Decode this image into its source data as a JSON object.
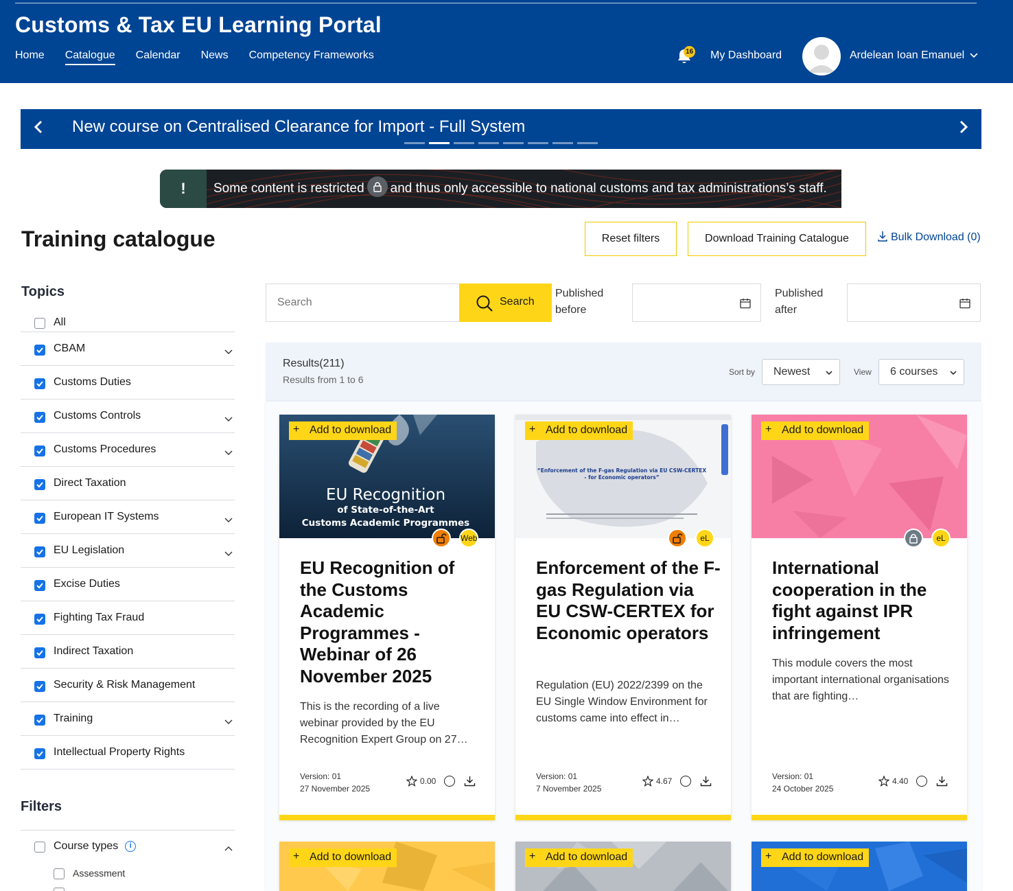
{
  "header": {
    "title": "Customs & Tax EU Learning Portal",
    "nav": [
      "Home",
      "Catalogue",
      "Calendar",
      "News",
      "Competency Frameworks"
    ],
    "notifications_count": "16",
    "dashboard_label": "My Dashboard",
    "user_name": "Ardelean Ioan Emanuel"
  },
  "carousel": {
    "headline": "New course on Centralised Clearance for Import - Full System",
    "slide_count": 8,
    "active_slide": 2
  },
  "notice": {
    "icon_text": "!",
    "text_before": "Some content is restricted",
    "text_after": "and thus only accessible to national customs and tax administrations’s staff."
  },
  "page": {
    "title": "Training catalogue",
    "reset_label": "Reset filters",
    "download_catalogue_label": "Download Training Catalogue",
    "bulk_download_label": "Bulk Download (0)"
  },
  "topics": {
    "heading": "Topics",
    "items": [
      {
        "label": "All",
        "checked": false,
        "expandable": false
      },
      {
        "label": "CBAM",
        "checked": true,
        "expandable": true
      },
      {
        "label": "Customs Duties",
        "checked": true,
        "expandable": false
      },
      {
        "label": "Customs Controls",
        "checked": true,
        "expandable": true
      },
      {
        "label": "Customs Procedures",
        "checked": true,
        "expandable": true
      },
      {
        "label": "Direct Taxation",
        "checked": true,
        "expandable": false
      },
      {
        "label": "European IT Systems",
        "checked": true,
        "expandable": true
      },
      {
        "label": "EU Legislation",
        "checked": true,
        "expandable": true
      },
      {
        "label": "Excise Duties",
        "checked": true,
        "expandable": false
      },
      {
        "label": "Fighting Tax Fraud",
        "checked": true,
        "expandable": false
      },
      {
        "label": "Indirect Taxation",
        "checked": true,
        "expandable": false
      },
      {
        "label": "Security & Risk Management",
        "checked": true,
        "expandable": false
      },
      {
        "label": "Training",
        "checked": true,
        "expandable": true
      },
      {
        "label": "Intellectual Property Rights",
        "checked": true,
        "expandable": false
      }
    ]
  },
  "filters": {
    "heading": "Filters",
    "course_types_label": "Course types",
    "course_types_info": "i",
    "course_type_options": [
      "Assessment"
    ]
  },
  "search": {
    "placeholder": "Search",
    "button_label": "Search",
    "published_before_line1": "Published",
    "published_before_line2": "before",
    "published_after_line1": "Published",
    "published_after_line2": "after"
  },
  "results": {
    "count_label": "Results(211)",
    "range_label": "Results from 1 to 6",
    "sort_by_label": "Sort by",
    "sort_value": "Newest",
    "view_label": "View",
    "view_value": "6 courses"
  },
  "cards": [
    {
      "add_label": "Add to download",
      "thumb_line1": "EU Recognition",
      "thumb_line2": "of State-of-the-Art",
      "thumb_line3": "Customs Academic Programmes",
      "format": "Web",
      "title": "EU Recognition of the Customs Academic Programmes - Webinar of 26 November 2025",
      "description": "This is the recording of a live webinar provided by the EU Recognition Expert Group on 27…",
      "version": "Version: 01",
      "date": "27 November 2025",
      "rating": "0.00"
    },
    {
      "add_label": "Add to download",
      "thumb_line1": "“Enforcement of the F-gas Regulation via EU CSW-CERTEX",
      "thumb_line2": "- for Economic operators”",
      "format": "eL",
      "title": "Enforcement of the F-gas Regulation via EU CSW-CERTEX for Economic operators",
      "description": "Regulation (EU) 2022/2399 on the EU Single Window Environment for customs came into effect in…",
      "version": "Version: 01",
      "date": "7 November 2025",
      "rating": "4.67"
    },
    {
      "add_label": "Add to download",
      "format": "eL",
      "title": "International cooperation in the fight against IPR infringement",
      "description": "This module covers the most important international organisations that are fighting…",
      "version": "Version: 01",
      "date": "24 October 2025",
      "rating": "4.40"
    },
    {
      "add_label": "Add to download"
    },
    {
      "add_label": "Add to download"
    },
    {
      "add_label": "Add to download"
    }
  ],
  "colors": {
    "brand_blue": "#004494",
    "accent_yellow": "#ffd617",
    "checkbox_blue": "#1672e6",
    "lock_open_orange": "#f07e00",
    "card3_pink": "#f77fa6",
    "card4_yellow": "#ffc94d",
    "card5_gray": "#b9bec4",
    "card6_blue": "#1f6fd6"
  }
}
